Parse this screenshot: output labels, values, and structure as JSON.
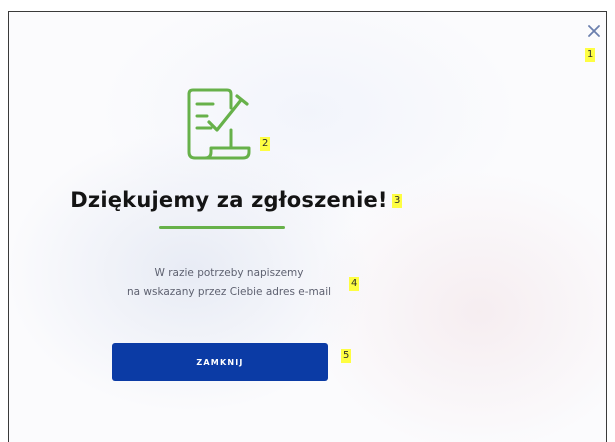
{
  "dialog": {
    "close_icon_glyph": "✕",
    "title": "Dziękujemy za zgłoszenie!",
    "message_lines": [
      "W razie potrzeby napiszemy",
      "na wskazany przez Ciebie adres e-mail"
    ],
    "close_button_label": "ZAMKNIJ",
    "success_icon": "document-checkmark-icon"
  },
  "markers": [
    "1",
    "2",
    "3",
    "4",
    "5"
  ],
  "colors": {
    "accent_green": "#67b14a",
    "button_blue": "#0b3ba5",
    "close_icon": "#6b7fae",
    "marker_yellow": "#ffff33",
    "title_text": "#141414",
    "message_text": "#5e6170"
  }
}
